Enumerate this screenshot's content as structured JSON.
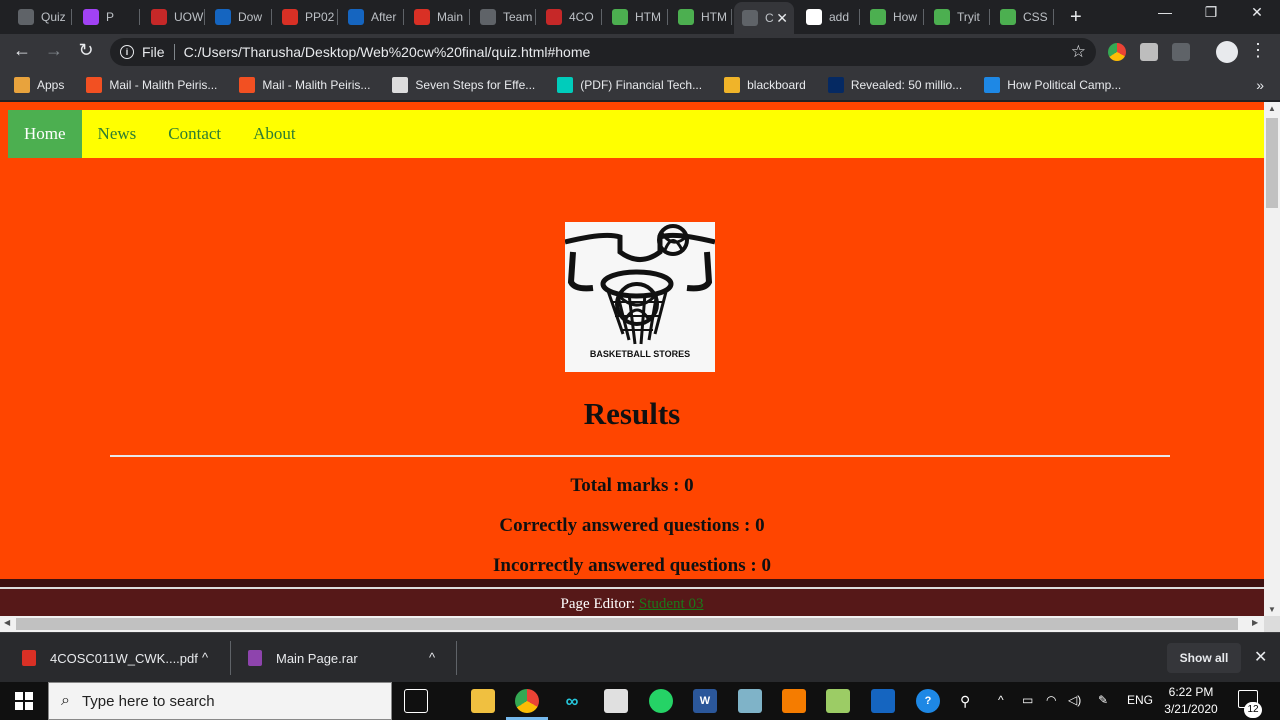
{
  "tabs": [
    {
      "title": "Quiz",
      "icon": "globe-icon",
      "color": "#5f6368"
    },
    {
      "title": "P",
      "icon": "video-icon",
      "color": "#a142f4"
    },
    {
      "title": "UOW",
      "icon": "uow-icon",
      "color": "#c62828"
    },
    {
      "title": "Dow",
      "icon": "download-icon",
      "color": "#1565c0"
    },
    {
      "title": "PP02",
      "icon": "gmail-icon",
      "color": "#d93025"
    },
    {
      "title": "After",
      "icon": "download-icon",
      "color": "#1565c0"
    },
    {
      "title": "Main",
      "icon": "gmail-icon",
      "color": "#d93025"
    },
    {
      "title": "Team",
      "icon": "globe-icon",
      "color": "#5f6368"
    },
    {
      "title": "4CO",
      "icon": "uow-icon",
      "color": "#c62828"
    },
    {
      "title": "HTM",
      "icon": "w3schools-icon",
      "color": "#4caf50"
    },
    {
      "title": "HTM",
      "icon": "w3schools-icon",
      "color": "#4caf50"
    },
    {
      "title": "C",
      "icon": "globe-icon",
      "color": "#5f6368"
    },
    {
      "title": "add",
      "icon": "google-icon",
      "color": "#ffffff"
    },
    {
      "title": "How",
      "icon": "w3schools-icon",
      "color": "#4caf50"
    },
    {
      "title": "Tryit",
      "icon": "w3schools-icon",
      "color": "#4caf50"
    },
    {
      "title": "CSS",
      "icon": "w3schools-icon",
      "color": "#4caf50"
    }
  ],
  "omnibox": {
    "scheme_label": "File",
    "url": "C:/Users/Tharusha/Desktop/Web%20cw%20final/quiz.html#home"
  },
  "bookmarks": [
    {
      "label": "Apps",
      "icon": "apps-grid-icon",
      "color": "#e8a33d"
    },
    {
      "label": "Mail - Malith Peiris...",
      "icon": "microsoft-icon",
      "color": "#f25022"
    },
    {
      "label": "Mail - Malith Peiris...",
      "icon": "microsoft-icon",
      "color": "#f25022"
    },
    {
      "label": "Seven Steps for Effe...",
      "icon": "seven-steps-icon",
      "color": "#dddddd"
    },
    {
      "label": "(PDF) Financial Tech...",
      "icon": "researchgate-icon",
      "color": "#00ccbb"
    },
    {
      "label": "blackboard",
      "icon": "pencil-icon",
      "color": "#f0b429"
    },
    {
      "label": "Revealed: 50 millio...",
      "icon": "guardian-icon",
      "color": "#052962"
    },
    {
      "label": "How Political Camp...",
      "icon": "site-icon",
      "color": "#1e88e5"
    }
  ],
  "page": {
    "nav": [
      "Home",
      "News",
      "Contact",
      "About"
    ],
    "logo_text": "BASKETBALL STORES",
    "results_title": "Results",
    "stats": [
      "Total marks : 0",
      "Correctly answered questions : 0",
      "Incorrectly answered questions : 0"
    ],
    "footer_label": "Page Editor:",
    "footer_link": "Student 03"
  },
  "downloads": [
    {
      "name": "4COSC011W_CWK....pdf",
      "icon": "pdf-icon",
      "color": "#d93025"
    },
    {
      "name": "Main Page.rar",
      "icon": "rar-icon",
      "color": "#8e44ad"
    }
  ],
  "downloads_show_all": "Show all",
  "taskbar": {
    "search_placeholder": "Type here to search",
    "language": "ENG",
    "time": "6:22 PM",
    "date": "3/21/2020",
    "notification_count": "12"
  }
}
